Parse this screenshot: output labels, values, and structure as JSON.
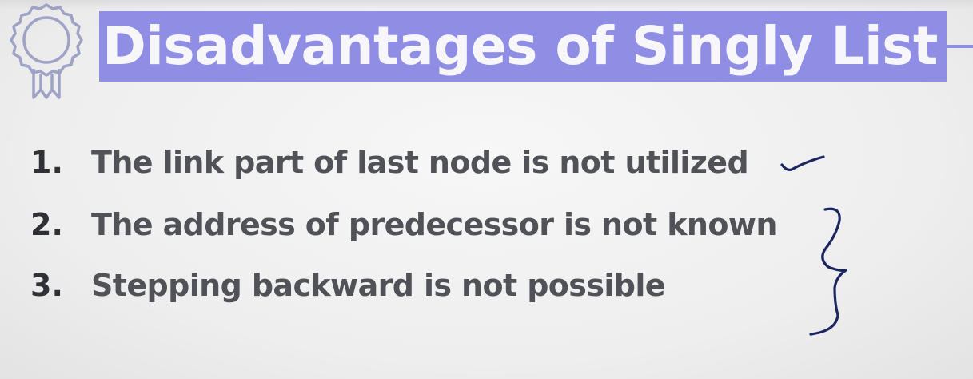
{
  "slide": {
    "title": "Disadvantages of Singly List",
    "badge_icon": "ribbon-award-icon",
    "accent_color": "#8f8ee4",
    "points": [
      {
        "number": "1.",
        "text": "The link part of last node is not utilized"
      },
      {
        "number": "2.",
        "text": "The address of predecessor is not known"
      },
      {
        "number": "3.",
        "text": "Stepping backward is not possible"
      }
    ],
    "annotations": {
      "checkmark": "checkmark-icon",
      "brace": "curly-brace-icon",
      "ink_color": "#1b2560"
    }
  }
}
